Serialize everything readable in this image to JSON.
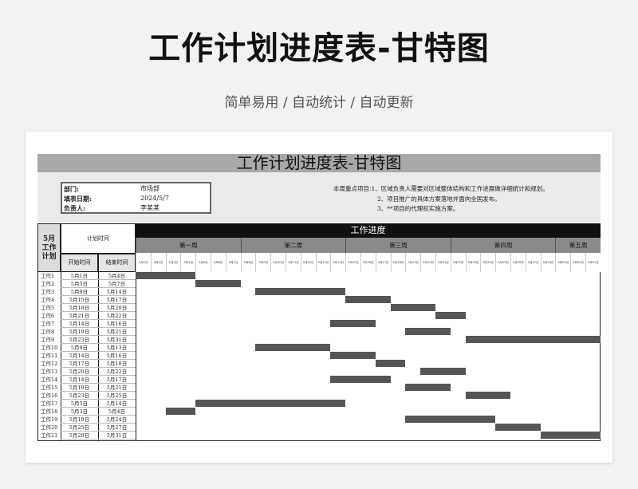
{
  "header": {
    "title": "工作计划进度表-甘特图",
    "subtitle": "简单易用 / 自动统计 / 自动更新"
  },
  "sheet": {
    "title": "工作计划进度表-甘特图",
    "info": [
      {
        "label": "部门:",
        "value": "市场部"
      },
      {
        "label": "填表日期:",
        "value": "2024/5/7"
      },
      {
        "label": "负责人:",
        "value": "李某某"
      }
    ],
    "notes": [
      "本周重点项目:1、区域负责人需要对区域整体结构和工作进展做详细统计和规划。",
      "2、项目推广的具体方案落地并面向全国发布。",
      "3、**项目的代理权实施方案。"
    ],
    "month_label": "5月 工作 计划",
    "plan_time_label": "计划时间",
    "start_label": "开始时间",
    "end_label": "结束时间",
    "progress_label": "工作进度",
    "weeks": [
      "第一周",
      "第二周",
      "第三周",
      "第四周",
      "第五周"
    ],
    "days": [
      "5月1日",
      "5月2日",
      "5月3日",
      "5月4日",
      "5月5日",
      "5月6日",
      "5月7日",
      "5月8日",
      "5月9日",
      "5月10日",
      "5月11日",
      "5月12日",
      "5月13日",
      "5月14日",
      "5月15日",
      "5月16日",
      "5月17日",
      "5月18日",
      "5月19日",
      "5月20日",
      "5月21日",
      "5月22日",
      "5月23日",
      "5月24日",
      "5月25日",
      "5月26日",
      "5月27日",
      "5月28日",
      "5月29日",
      "5月30日",
      "5月31日"
    ],
    "tasks": [
      {
        "name": "工作1",
        "start": "5月1日",
        "end": "5月4日",
        "s": 1,
        "e": 4
      },
      {
        "name": "工作2",
        "start": "5月5日",
        "end": "5月7日",
        "s": 5,
        "e": 7
      },
      {
        "name": "工作3",
        "start": "5月9日",
        "end": "5月14日",
        "s": 9,
        "e": 14
      },
      {
        "name": "工作4",
        "start": "5月15日",
        "end": "5月17日",
        "s": 15,
        "e": 17
      },
      {
        "name": "工作5",
        "start": "5月18日",
        "end": "5月20日",
        "s": 18,
        "e": 20
      },
      {
        "name": "工作6",
        "start": "5月21日",
        "end": "5月22日",
        "s": 21,
        "e": 22
      },
      {
        "name": "工作7",
        "start": "5月14日",
        "end": "5月16日",
        "s": 14,
        "e": 16
      },
      {
        "name": "工作8",
        "start": "5月19日",
        "end": "5月21日",
        "s": 19,
        "e": 21
      },
      {
        "name": "工作9",
        "start": "5月23日",
        "end": "5月31日",
        "s": 23,
        "e": 31
      },
      {
        "name": "工作10",
        "start": "5月9日",
        "end": "5月13日",
        "s": 9,
        "e": 13
      },
      {
        "name": "工作11",
        "start": "5月14日",
        "end": "5月16日",
        "s": 14,
        "e": 16
      },
      {
        "name": "工作12",
        "start": "5月17日",
        "end": "5月18日",
        "s": 17,
        "e": 18
      },
      {
        "name": "工作13",
        "start": "5月20日",
        "end": "5月22日",
        "s": 20,
        "e": 22
      },
      {
        "name": "工作14",
        "start": "5月14日",
        "end": "5月17日",
        "s": 14,
        "e": 17
      },
      {
        "name": "工作15",
        "start": "5月19日",
        "end": "5月21日",
        "s": 19,
        "e": 21
      },
      {
        "name": "工作16",
        "start": "5月23日",
        "end": "5月25日",
        "s": 23,
        "e": 25
      },
      {
        "name": "工作17",
        "start": "5月5日",
        "end": "5月14日",
        "s": 5,
        "e": 14
      },
      {
        "name": "工作18",
        "start": "5月3日",
        "end": "5月4日",
        "s": 3,
        "e": 4
      },
      {
        "name": "工作19",
        "start": "5月19日",
        "end": "5月24日",
        "s": 19,
        "e": 24
      },
      {
        "name": "工作20",
        "start": "5月25日",
        "end": "5月27日",
        "s": 25,
        "e": 27
      },
      {
        "name": "工作21",
        "start": "5月28日",
        "end": "5月31日",
        "s": 28,
        "e": 31
      }
    ]
  },
  "colors": {
    "bar": "#555555",
    "title_band": "#a8a8a8",
    "week_band": "#8a8a8a",
    "progress_band": "#111111"
  }
}
